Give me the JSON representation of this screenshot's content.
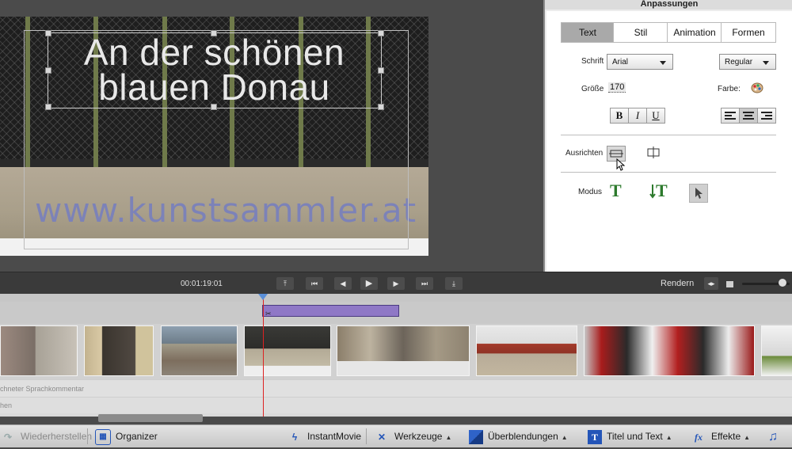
{
  "preview": {
    "title_line1": "An der schönen",
    "title_line2": "blauen Donau",
    "graffiti": "www.kunstsammler.at"
  },
  "adjust_panel": {
    "header": "Anpassungen",
    "tabs": [
      {
        "label": "Text",
        "active": true
      },
      {
        "label": "Stil",
        "active": false
      },
      {
        "label": "Animation",
        "active": false
      },
      {
        "label": "Formen",
        "active": false
      }
    ],
    "font_label": "Schrift",
    "font_value": "Arial",
    "style_value": "Regular",
    "size_label": "Größe",
    "size_value": "170",
    "color_label": "Farbe:",
    "bold": "B",
    "italic": "I",
    "underline": "U",
    "align_label": "Ausrichten",
    "mode_label": "Modus",
    "mode_t1": "T",
    "mode_t2": "T"
  },
  "transport": {
    "timecode": "00:01:19:01",
    "render_label": "Rendern"
  },
  "timeline": {
    "title_clip_icon": "✂",
    "audio_track_1": "chneter Sprachkommentar",
    "audio_track_2": "hen"
  },
  "actionbar": {
    "redo": "Wiederherstellen",
    "organizer": "Organizer",
    "instantmovie": "InstantMovie",
    "tools": "Werkzeuge",
    "transitions": "Überblendungen",
    "titles": "Titel und Text",
    "effects": "Effekte"
  },
  "icons": [
    "redo-icon",
    "organizer-icon",
    "lightning-icon",
    "tools-icon",
    "transitions-icon",
    "title-icon",
    "fx-icon",
    "music-icon"
  ],
  "colors": {
    "accent": "#2455b8",
    "title_clip": "#8f78c6",
    "playhead": "#d22222",
    "mode_green": "#2d7a2d"
  }
}
